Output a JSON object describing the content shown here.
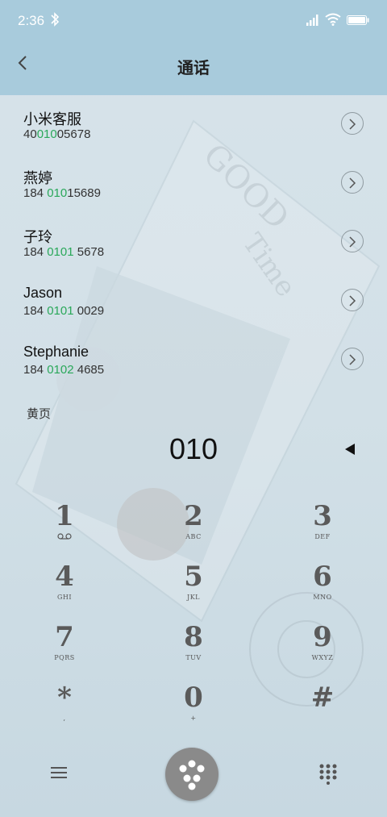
{
  "status_bar": {
    "time": "2:36"
  },
  "header": {
    "title": "通话"
  },
  "results": [
    {
      "name": "小米客服",
      "number_pre": "40",
      "number_hl": "010",
      "number_post": "05678"
    },
    {
      "name": "燕婷",
      "number_pre": "184 ",
      "number_hl": "010",
      "number_post": "15689"
    },
    {
      "name": "子玲",
      "number_pre": "184 ",
      "number_hl": "0101",
      "number_post": " 5678"
    },
    {
      "name": "Jason",
      "number_pre": "184 ",
      "number_hl": "0101",
      "number_post": " 0029"
    },
    {
      "name": "Stephanie",
      "number_pre": "184 ",
      "number_hl": "0102",
      "number_post": " 4685"
    }
  ],
  "section": {
    "label": "黄页"
  },
  "dial": {
    "input": "010"
  },
  "keypad": [
    {
      "digit": "1",
      "letters": ""
    },
    {
      "digit": "2",
      "letters": "ABC"
    },
    {
      "digit": "3",
      "letters": "DEF"
    },
    {
      "digit": "4",
      "letters": "GHI"
    },
    {
      "digit": "5",
      "letters": "JKL"
    },
    {
      "digit": "6",
      "letters": "MNO"
    },
    {
      "digit": "7",
      "letters": "PQRS"
    },
    {
      "digit": "8",
      "letters": "TUV"
    },
    {
      "digit": "9",
      "letters": "WXYZ"
    },
    {
      "digit": "*",
      "letters": ","
    },
    {
      "digit": "0",
      "letters": "+"
    },
    {
      "digit": "#",
      "letters": ""
    }
  ],
  "background": {
    "watermark_text": "GOOD Time"
  },
  "colors": {
    "accent_green": "#2aa85a",
    "header_bg": "#a8cbdc",
    "call_button": "#8a8a8a"
  },
  "icons": [
    "bluetooth-icon",
    "signal-icon",
    "wifi-icon",
    "battery-icon",
    "back-icon",
    "chevron-right-icon",
    "backspace-icon",
    "voicemail-icon",
    "menu-icon",
    "call-icon",
    "dialpad-icon"
  ]
}
